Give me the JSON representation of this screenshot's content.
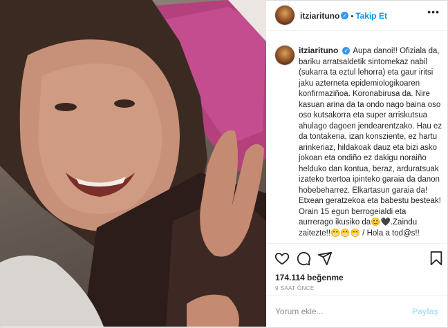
{
  "post": {
    "username": "itziarituno",
    "verified_mark": "✓",
    "separator": "•",
    "follow_label": "Takip Et",
    "more_label": "•••",
    "caption": "Aupa danoi!! Ofiziala da, bariku arratsaldetik sintomekaz nabil (sukarra ta eztul lehorra) eta gaur iritsi jaku azterneta epidemiologikoaren konfirmaziñoa. Koronabirusa da. Nire kasuan arina da ta ondo nago baina oso oso kutsakorra eta super arriskutsua ahulago dagoen jendearentzako. Hau ez da tontakeria, izan konsziente, ez hartu arinkeriaz, hildakoak dauz eta bizi asko jokoan eta ondiño ez dakigu noraiño helduko dan kontua, beraz, arduratsuak izateko txertoa ipinteko garaia da danon hobebeharrez. Elkartasun garaia da! Etxean geratzekoa eta babestu besteak! Orain 15 egun berrogeialdi eta aurrerago ikusiko da😊🖤.Zaindu zaitezte!!😁😁😁 / Hola a tod@s!!",
    "likes_text": "174.114 beğenme",
    "time_text": "9 SAAT ÖNCE",
    "comment_placeholder": "Yorum ekle...",
    "post_label": "Paylaş",
    "icons": [
      "heart-icon",
      "comment-icon",
      "share-icon",
      "bookmark-icon",
      "more-options-icon",
      "verified-badge-icon"
    ],
    "colors": {
      "accent": "#0095f6",
      "post_disabled": "#b2dffc",
      "muted": "#8e8e8e",
      "text": "#262626",
      "verified": "#3897f0"
    }
  }
}
